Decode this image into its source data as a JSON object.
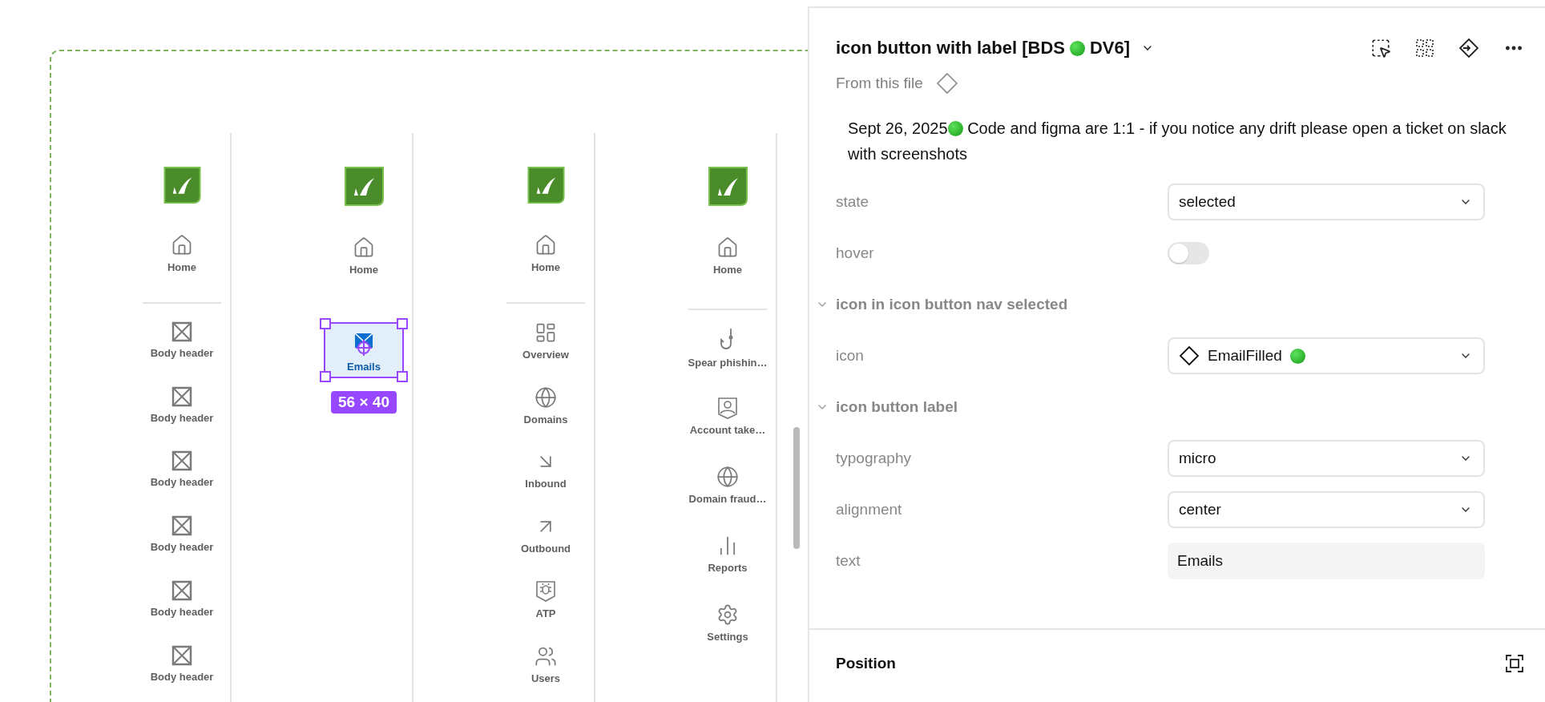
{
  "canvas": {
    "columns": [
      {
        "home": "Home",
        "divider": true,
        "items": [
          {
            "kind": "placeholder",
            "label": "Body header",
            "selected": false
          },
          {
            "kind": "placeholder",
            "label": "Body header",
            "selected": false
          },
          {
            "kind": "placeholder",
            "label": "Body header",
            "selected": false
          },
          {
            "kind": "placeholder",
            "label": "Body header",
            "selected": false
          },
          {
            "kind": "placeholder",
            "label": "Body header",
            "selected": false
          },
          {
            "kind": "placeholder",
            "label": "Body header",
            "selected": false
          }
        ]
      },
      {
        "home": "Home",
        "divider": false,
        "items": [
          {
            "kind": "email",
            "label": "Emails",
            "selected": true,
            "size_label": "56 × 40"
          }
        ]
      },
      {
        "home": "Home",
        "divider": true,
        "items": [
          {
            "kind": "overview",
            "label": "Overview",
            "selected": false
          },
          {
            "kind": "globe",
            "label": "Domains",
            "selected": false
          },
          {
            "kind": "arrow-in",
            "label": "Inbound",
            "selected": false
          },
          {
            "kind": "arrow-out",
            "label": "Outbound",
            "selected": false
          },
          {
            "kind": "shield-bug",
            "label": "ATP",
            "selected": false
          },
          {
            "kind": "users",
            "label": "Users",
            "selected": false
          }
        ]
      },
      {
        "home": "Home",
        "divider": true,
        "items": [
          {
            "kind": "hook",
            "label": "Spear phishin…",
            "selected": false
          },
          {
            "kind": "badge-user",
            "label": "Account take…",
            "selected": false
          },
          {
            "kind": "globe",
            "label": "Domain fraud…",
            "selected": false
          },
          {
            "kind": "chart",
            "label": "Reports",
            "selected": false
          },
          {
            "kind": "gear",
            "label": "Settings",
            "selected": false
          }
        ]
      }
    ]
  },
  "panel": {
    "title": {
      "before": "icon button with label [BDS",
      "dot": true,
      "after": "DV6]"
    },
    "source": "From this file",
    "description": {
      "before": "Sept 26, 2025",
      "dot": true,
      "after": "Code and figma are 1:1 - if you notice any drift please open a ticket on slack with screenshots"
    },
    "properties": [
      {
        "kind": "select",
        "label": "state",
        "value": "selected"
      },
      {
        "kind": "toggle",
        "label": "hover",
        "on": false
      },
      {
        "kind": "section",
        "label": "icon in icon button nav selected",
        "expanded": true
      },
      {
        "kind": "select",
        "label": "icon",
        "value": "EmailFilled",
        "component": true,
        "dot": true
      },
      {
        "kind": "section",
        "label": "icon button label",
        "expanded": true
      },
      {
        "kind": "select",
        "label": "typography",
        "value": "micro"
      },
      {
        "kind": "select",
        "label": "alignment",
        "value": "center"
      },
      {
        "kind": "text",
        "label": "text",
        "value": "Emails"
      }
    ],
    "position": {
      "title": "Position"
    }
  }
}
